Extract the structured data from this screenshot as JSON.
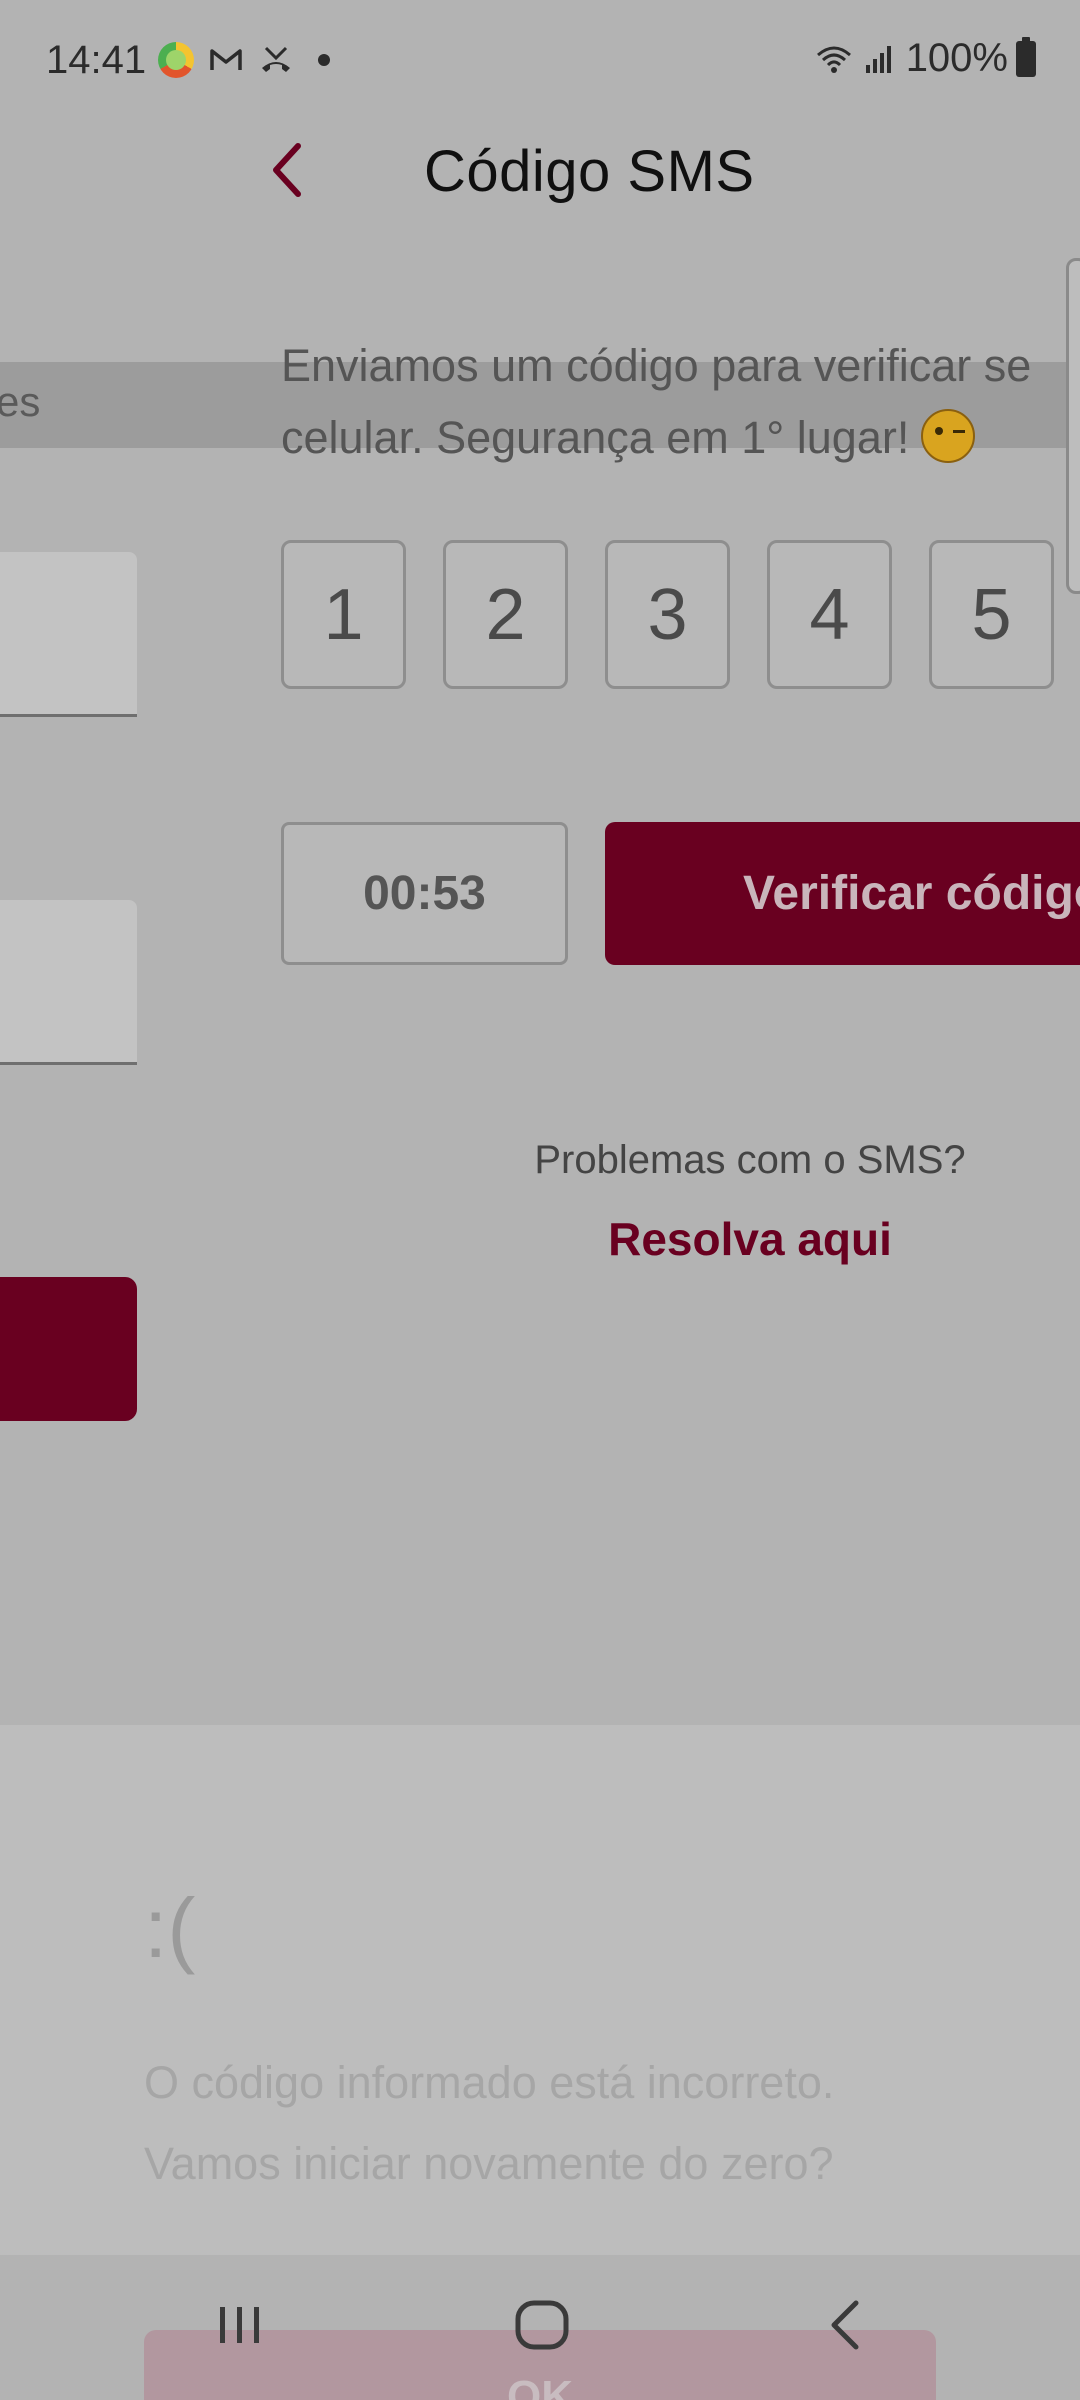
{
  "status_bar": {
    "time": "14:41",
    "battery": "100%",
    "notification_icons": [
      "alelo-app-icon",
      "gmail-icon",
      "missed-call-icon",
      "more-dot-icon"
    ]
  },
  "background_screen": {
    "strip_text": "es"
  },
  "header": {
    "title": "Código SMS",
    "back_icon": "chevron-left-icon"
  },
  "description": {
    "line1": "Enviamos um código para verificar se",
    "line2": "celular. Segurança em 1° lugar!",
    "emoji": "winking-face-icon"
  },
  "code_digits": [
    "1",
    "2",
    "3",
    "4",
    "5"
  ],
  "timer": "00:53",
  "verify_button": "Verificar código",
  "help": {
    "question": "Problemas com o SMS?",
    "link": "Resolva aqui"
  },
  "error_sheet": {
    "emoticon": ":(",
    "line1": "O código informado está incorreto.",
    "line2": "Vamos iniciar novamente do zero?",
    "ok_button": "OK"
  },
  "colors": {
    "brand": "#690020",
    "overlay": "#b3b3b3"
  }
}
